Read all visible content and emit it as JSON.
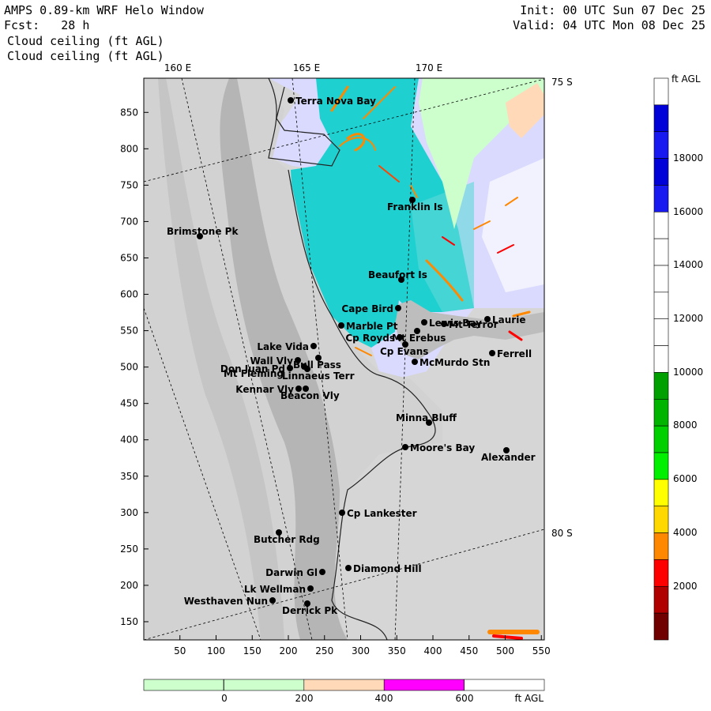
{
  "header": {
    "title": "AMPS 0.89-km WRF Helo Window",
    "forecast": "Fcst:   28 h",
    "field_line1": "Cloud ceiling (ft AGL)",
    "field_line2": "Cloud ceiling (ft AGL)",
    "init": "Init: 00 UTC Sun 07 Dec 25",
    "valid": "Valid: 04 UTC Mon 08 Dec 25"
  },
  "map": {
    "lon_labels": [
      {
        "text": "160 E",
        "key": "lon160"
      },
      {
        "text": "165 E",
        "key": "lon165"
      },
      {
        "text": "170 E",
        "key": "lon170"
      }
    ],
    "lat_labels": [
      {
        "text": "75 S",
        "key": "lat75"
      },
      {
        "text": "80 S",
        "key": "lat80"
      }
    ],
    "x_ticks": [
      "50",
      "100",
      "150",
      "200",
      "250",
      "300",
      "350",
      "400",
      "450",
      "500",
      "550"
    ],
    "y_ticks": [
      "850",
      "800",
      "750",
      "700",
      "650",
      "600",
      "550",
      "500",
      "450",
      "400",
      "350",
      "300",
      "250",
      "200",
      "150"
    ],
    "places": [
      {
        "name": "Terra Nova Bay",
        "key": "terra_nova_bay"
      },
      {
        "name": "Franklin Is",
        "key": "franklin_is"
      },
      {
        "name": "Brimstone Pk",
        "key": "brimstone_pk"
      },
      {
        "name": "Beaufort Is",
        "key": "beaufort_is"
      },
      {
        "name": "Cape Bird",
        "key": "cape_bird"
      },
      {
        "name": "Lewis Bay",
        "key": "lewis_bay"
      },
      {
        "name": "Laurie",
        "key": "laurie"
      },
      {
        "name": "Marble Pt",
        "key": "marble_pt"
      },
      {
        "name": "Mt Terror",
        "key": "mt_terror"
      },
      {
        "name": "Cp Royds",
        "key": "cp_royds"
      },
      {
        "name": "Mt Erebus",
        "key": "mt_erebus"
      },
      {
        "name": "Lake Vida",
        "key": "lake_vida"
      },
      {
        "name": "Cp Evans",
        "key": "cp_evans"
      },
      {
        "name": "Ferrell",
        "key": "ferrell"
      },
      {
        "name": "Wall Vly",
        "key": "wall_vly"
      },
      {
        "name": "McMurdo Stn",
        "key": "mcmurdo_stn"
      },
      {
        "name": "Don Juan Pd",
        "key": "don_juan_pd"
      },
      {
        "name": "Bull Pass",
        "key": "bull_pass"
      },
      {
        "name": "Mt Fleming",
        "key": "mt_fleming"
      },
      {
        "name": "Linnaeus Terr",
        "key": "linnaeus_terr"
      },
      {
        "name": "Kennar Vly",
        "key": "kennar_vly"
      },
      {
        "name": "Beacon Vly",
        "key": "beacon_vly"
      },
      {
        "name": "Minna Bluff",
        "key": "minna_bluff"
      },
      {
        "name": "Moore's Bay",
        "key": "moores_bay"
      },
      {
        "name": "Alexander",
        "key": "alexander"
      },
      {
        "name": "Cp Lankester",
        "key": "cp_lankester"
      },
      {
        "name": "Butcher Rdg",
        "key": "butcher_rdg"
      },
      {
        "name": "Darwin Gl",
        "key": "darwin_gl"
      },
      {
        "name": "Diamond Hill",
        "key": "diamond_hill"
      },
      {
        "name": "Lk Wellman",
        "key": "lk_wellman"
      },
      {
        "name": "Westhaven Nun",
        "key": "westhaven_nun"
      },
      {
        "name": "Derrick Pk",
        "key": "derrick_pk"
      }
    ]
  },
  "colorbar_right": {
    "unit": "ft AGL",
    "labels": [
      "18000",
      "16000",
      "14000",
      "12000",
      "10000",
      "8000",
      "6000",
      "4000",
      "2000"
    ],
    "bins": [
      {
        "color": "#ffffff"
      },
      {
        "color": "#0000d8"
      },
      {
        "color": "#1818f0"
      },
      {
        "color": "#0000d8"
      },
      {
        "color": "#1818f0"
      },
      {
        "color": "#ffffff"
      },
      {
        "color": "#ffffff"
      },
      {
        "color": "#ffffff"
      },
      {
        "color": "#ffffff"
      },
      {
        "color": "#ffffff"
      },
      {
        "color": "#ffffff"
      },
      {
        "color": "#00a000"
      },
      {
        "color": "#00b400"
      },
      {
        "color": "#00d000"
      },
      {
        "color": "#00f000"
      },
      {
        "color": "#ffff00"
      },
      {
        "color": "#ffd800"
      },
      {
        "color": "#ff8800"
      },
      {
        "color": "#ff0000"
      },
      {
        "color": "#b00000"
      },
      {
        "color": "#700000"
      }
    ]
  },
  "colorbar_bottom": {
    "unit": "ft AGL",
    "labels": [
      "0",
      "200",
      "400",
      "600"
    ],
    "bins": [
      {
        "color": "#ccffcc"
      },
      {
        "color": "#ccffcc"
      },
      {
        "color": "#ffd9b8"
      },
      {
        "color": "#ff00ff"
      },
      {
        "color": "#ffffff"
      }
    ]
  },
  "colors": {
    "land": "#d6d6d6",
    "ice_shelf": "#d0d0d0",
    "cyan_band": "#1fd0d0",
    "lavender": "#dadaff",
    "pale_green": "#ccffcc",
    "peach": "#ffd9b8"
  }
}
